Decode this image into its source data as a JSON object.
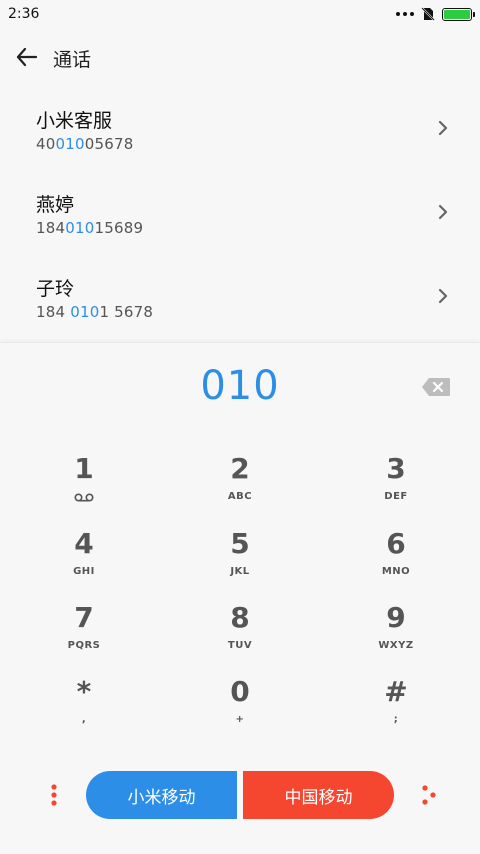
{
  "status": {
    "time": "2:36",
    "battery_color": "#2ecc40"
  },
  "header": {
    "title": "通话"
  },
  "results": [
    {
      "name": "小米客服",
      "number_parts": [
        "40",
        "010",
        "05678"
      ]
    },
    {
      "name": "燕婷",
      "number_parts": [
        "184",
        "010",
        "15689"
      ]
    },
    {
      "name": "子玲",
      "number_parts": [
        "184 ",
        "010",
        "1 5678"
      ]
    }
  ],
  "dialer": {
    "display": "010",
    "keys": [
      {
        "digit": "1",
        "letters": ""
      },
      {
        "digit": "2",
        "letters": "ABC"
      },
      {
        "digit": "3",
        "letters": "DEF"
      },
      {
        "digit": "4",
        "letters": "GHI"
      },
      {
        "digit": "5",
        "letters": "JKL"
      },
      {
        "digit": "6",
        "letters": "MNO"
      },
      {
        "digit": "7",
        "letters": "PQRS"
      },
      {
        "digit": "8",
        "letters": "TUV"
      },
      {
        "digit": "9",
        "letters": "WXYZ"
      },
      {
        "digit": "*",
        "letters": ","
      },
      {
        "digit": "0",
        "letters": "+"
      },
      {
        "digit": "#",
        "letters": ";"
      }
    ]
  },
  "bottom": {
    "sim1_label": "小米移动",
    "sim2_label": "中国移动",
    "sim1_color": "#2d8ee8",
    "sim2_color": "#f5472f"
  },
  "colors": {
    "accent": "#2d8ee8",
    "danger": "#f5472f"
  }
}
